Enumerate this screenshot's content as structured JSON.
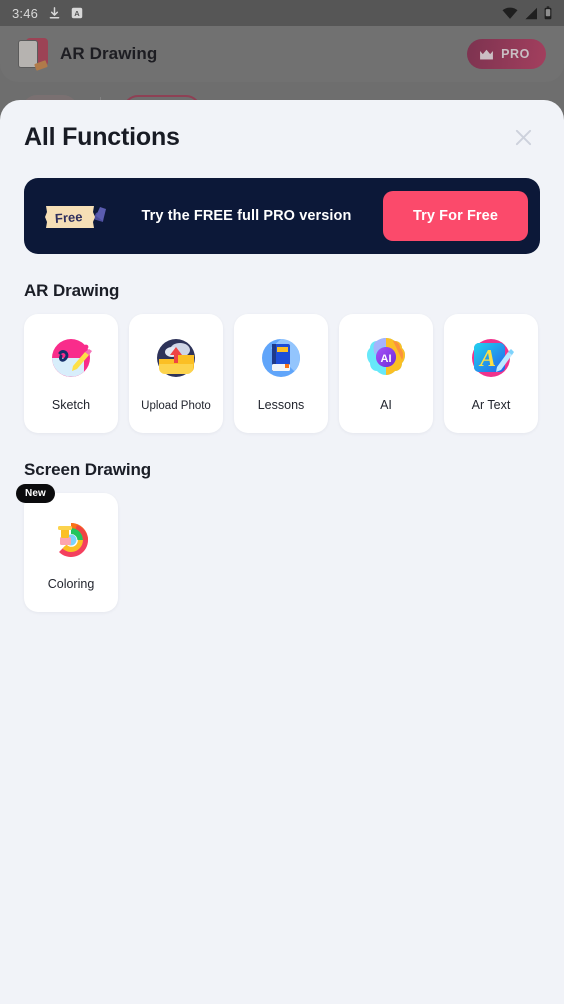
{
  "status_bar": {
    "time": "3:46",
    "icons": [
      "download-icon",
      "a-badge-icon",
      "wifi-icon",
      "signal-icon",
      "battery-icon"
    ]
  },
  "app_bar": {
    "title": "AR Drawing",
    "logo_icon": "ar-drawing-logo-icon",
    "pro_button": {
      "label": "PRO",
      "icon": "crown-icon"
    }
  },
  "sheet": {
    "title": "All Functions",
    "close_icon": "close-icon"
  },
  "promo": {
    "ticket_label": "Free",
    "message": "Try the FREE full PRO version",
    "cta_label": "Try For Free",
    "bg_color": "#0C1838",
    "cta_color": "#FB4A6B"
  },
  "sections": [
    {
      "title": "AR Drawing",
      "items": [
        {
          "label": "Sketch",
          "icon": "sketch-icon",
          "badge": null
        },
        {
          "label": "Upload Photo",
          "icon": "upload-photo-icon",
          "badge": null
        },
        {
          "label": "Lessons",
          "icon": "lessons-icon",
          "badge": null
        },
        {
          "label": "AI",
          "icon": "ai-icon",
          "badge": null
        },
        {
          "label": "Ar Text",
          "icon": "ar-text-icon",
          "badge": null
        }
      ]
    },
    {
      "title": "Screen Drawing",
      "items": [
        {
          "label": "Coloring",
          "icon": "coloring-icon",
          "badge": "New"
        }
      ]
    }
  ],
  "theme": {
    "sheet_bg": "#F1F3F8",
    "card_bg": "#FFFFFF",
    "text_primary": "#181B24",
    "badge_bg": "#0B0B0D"
  }
}
